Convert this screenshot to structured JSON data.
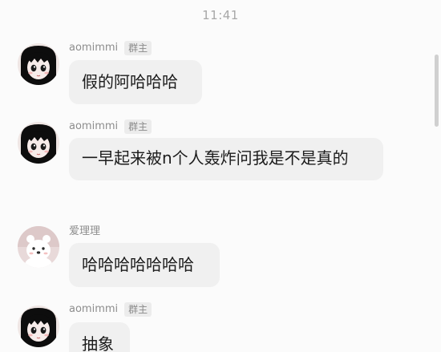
{
  "status": {
    "time": "11:41"
  },
  "messages": [
    {
      "name": "aomimmi",
      "badge": "群主",
      "text": "假的阿哈哈哈",
      "avatar": "girl-avatar-icon"
    },
    {
      "name": "aomimmi",
      "badge": "群主",
      "text": "一早起来被n个人轰炸问我是不是真的",
      "avatar": "girl-avatar-icon"
    },
    {
      "name": "爱理理",
      "badge": "",
      "text": "哈哈哈哈哈哈哈",
      "avatar": "bear-avatar-icon"
    },
    {
      "name": "aomimmi",
      "badge": "群主",
      "text": "抽象",
      "avatar": "girl-avatar-icon"
    }
  ],
  "colors": {
    "background": "#fbfbfb",
    "bubble": "#f0f0f0",
    "text": "#1b1b1b",
    "muted": "#8d8d8d",
    "badge_bg": "#ececec"
  }
}
